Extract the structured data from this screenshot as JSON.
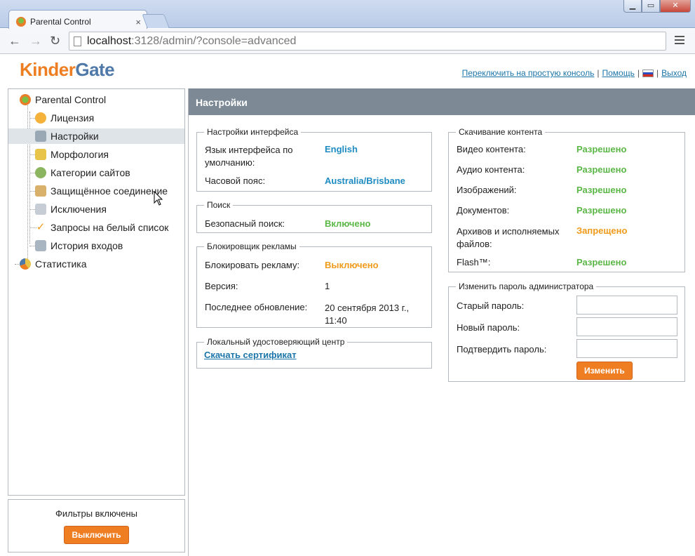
{
  "browser": {
    "tab_title": "Parental Control",
    "tab_close": "×",
    "url_host": "localhost",
    "url_rest": ":3128/admin/?console=advanced",
    "window_buttons": [
      "▁",
      "▭",
      "✕"
    ]
  },
  "header": {
    "logo_part1": "Kinder",
    "logo_part2": "Gate",
    "links": {
      "simple_console": "Переключить на простую консоль",
      "help": "Помощь",
      "logout": "Выход"
    },
    "separator": "|"
  },
  "sidebar": {
    "root": "Parental Control",
    "items": [
      {
        "label": "Лицензия",
        "icon": "license-icon"
      },
      {
        "label": "Настройки",
        "icon": "settings-icon"
      },
      {
        "label": "Морфология",
        "icon": "morphology-icon"
      },
      {
        "label": "Категории сайтов",
        "icon": "categories-icon"
      },
      {
        "label": "Защищённое соединение",
        "icon": "secure-connection-icon"
      },
      {
        "label": "Исключения",
        "icon": "exceptions-icon"
      },
      {
        "label": "Запросы на белый список",
        "icon": "checkmark-icon"
      },
      {
        "label": "История входов",
        "icon": "history-icon"
      }
    ],
    "stats": "Статистика",
    "selected": "Настройки"
  },
  "filter": {
    "status_text": "Фильтры включены",
    "button": "Выключить"
  },
  "content": {
    "title": "Настройки",
    "interface": {
      "legend": "Настройки интерфейса",
      "language_label_1": "Язык интерфейса по",
      "language_label_2": "умолчанию:",
      "language_value": "English",
      "timezone_label": "Часовой пояс:",
      "timezone_value": "Australia/Brisbane"
    },
    "search": {
      "legend": "Поиск",
      "safe_search_label": "Безопасный поиск:",
      "safe_search_value": "Включено"
    },
    "adblock": {
      "legend": "Блокировщик рекламы",
      "block_label": "Блокировать рекламу:",
      "block_value": "Выключено",
      "version_label": "Версия:",
      "version_value": "1",
      "updated_label": "Последнее обновление:",
      "updated_value_1": "20 сентября 2013 г.,",
      "updated_value_2": "11:40"
    },
    "ca": {
      "legend": "Локальный удостоверяющий центр",
      "download_link": "Скачать сертификат"
    },
    "downloads": {
      "legend": "Скачивание контента",
      "rows": [
        {
          "label": "Видео контента:",
          "value": "Разрешено",
          "status": "allowed"
        },
        {
          "label": "Аудио контента:",
          "value": "Разрешено",
          "status": "allowed"
        },
        {
          "label": "Изображений:",
          "value": "Разрешено",
          "status": "allowed"
        },
        {
          "label": "Документов:",
          "value": "Разрешено",
          "status": "allowed"
        },
        {
          "label": "Архивов и исполняемых",
          "label2": "файлов:",
          "value": "Запрещено",
          "status": "denied"
        },
        {
          "label": "Flash™:",
          "value": "Разрешено",
          "status": "allowed"
        }
      ]
    },
    "password": {
      "legend": "Изменить пароль администратора",
      "old_label": "Старый пароль:",
      "new_label": "Новый пароль:",
      "confirm_label": "Подтвердить пароль:",
      "old_value": "",
      "new_value": "",
      "confirm_value": "",
      "button": "Изменить"
    }
  },
  "colors": {
    "accent_orange": "#ef7d22",
    "allowed_green": "#5ab746",
    "denied_orange": "#f09a1a",
    "value_blue": "#1e8bc3",
    "header_gray": "#7d8a95"
  }
}
